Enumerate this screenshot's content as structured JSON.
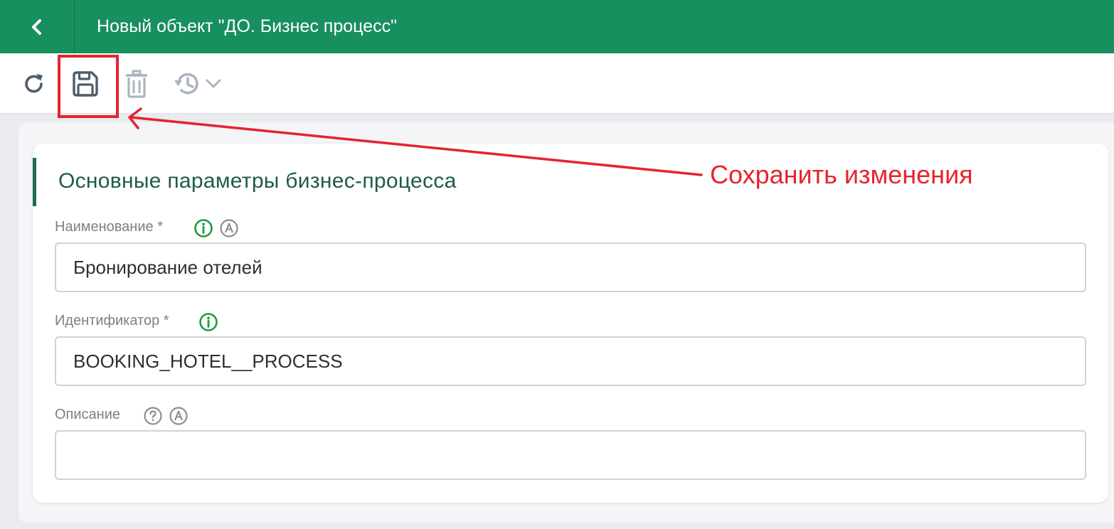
{
  "header": {
    "back_icon": "chevron-left-icon",
    "title": "Новый объект \"ДО. Бизнес процесс\""
  },
  "toolbar": {
    "buttons": [
      {
        "name": "refresh",
        "icon": "refresh-icon"
      },
      {
        "name": "save",
        "icon": "floppy-disk-icon",
        "highlighted": true
      },
      {
        "name": "delete",
        "icon": "trash-icon",
        "disabled": true
      },
      {
        "name": "history",
        "icon": "history-icon",
        "disabled": true
      }
    ]
  },
  "section": {
    "title": "Основные параметры бизнес-процесса"
  },
  "fields": {
    "name": {
      "label": "Наименование *",
      "value": "Бронирование отелей",
      "icons": [
        "info-icon",
        "auto-a-icon"
      ]
    },
    "identifier": {
      "label": "Идентификатор *",
      "value": "BOOKING_HOTEL__PROCESS",
      "icons": [
        "info-icon"
      ]
    },
    "description": {
      "label": "Описание",
      "value": "",
      "icons": [
        "help-icon",
        "auto-a-icon"
      ]
    }
  },
  "annotation": {
    "text": "Сохранить изменения"
  },
  "colors": {
    "header_bg": "#178f5f",
    "accent_green": "#1f6e4b",
    "info_green": "#1e9a3a",
    "annotation_red": "#e5242f",
    "toolbar_icon": "#4f5d6b",
    "disabled_icon": "#aab4c0"
  }
}
